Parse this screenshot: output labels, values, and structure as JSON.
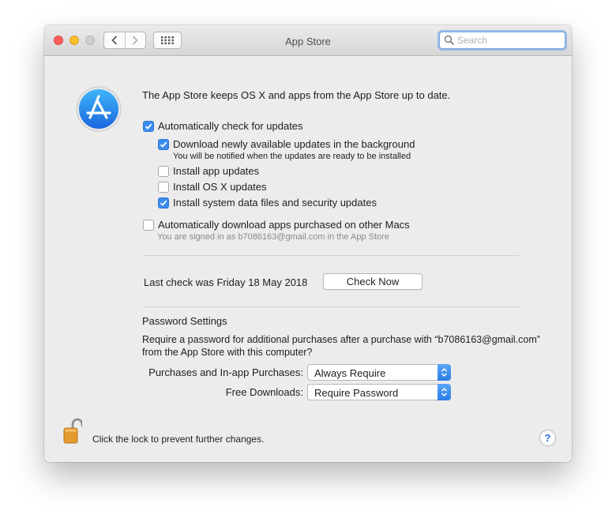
{
  "window": {
    "title": "App Store"
  },
  "search": {
    "placeholder": "Search"
  },
  "intro": "The App Store keeps OS X and apps from the App Store up to date.",
  "options": {
    "auto_check": {
      "label": "Automatically check for updates",
      "checked": true
    },
    "download_background": {
      "label": "Download newly available updates in the background",
      "checked": true,
      "note": "You will be notified when the updates are ready to be installed"
    },
    "install_app": {
      "label": "Install app updates",
      "checked": false
    },
    "install_osx": {
      "label": "Install OS X updates",
      "checked": false
    },
    "install_system": {
      "label": "Install system data files and security updates",
      "checked": true
    },
    "auto_download": {
      "label": "Automatically download apps purchased on other Macs",
      "checked": false,
      "note": "You are signed in as b7086163@gmail.com in the App Store"
    }
  },
  "last_check": {
    "text": "Last check was Friday 18 May 2018",
    "button": "Check Now"
  },
  "password": {
    "heading": "Password Settings",
    "desc_line1": "Require a password for additional purchases after a purchase with “b7086163@gmail.com”",
    "desc_line2": "from the App Store with this computer?",
    "purchases_label": "Purchases and In-app Purchases:",
    "purchases_value": "Always Require",
    "free_label": "Free Downloads:",
    "free_value": "Require Password"
  },
  "footer": {
    "lock_text": "Click the lock to prevent further changes.",
    "help": "?"
  },
  "colors": {
    "accent": "#3b8cf0",
    "close": "#fc5f57",
    "minimize": "#fdbc2e"
  }
}
